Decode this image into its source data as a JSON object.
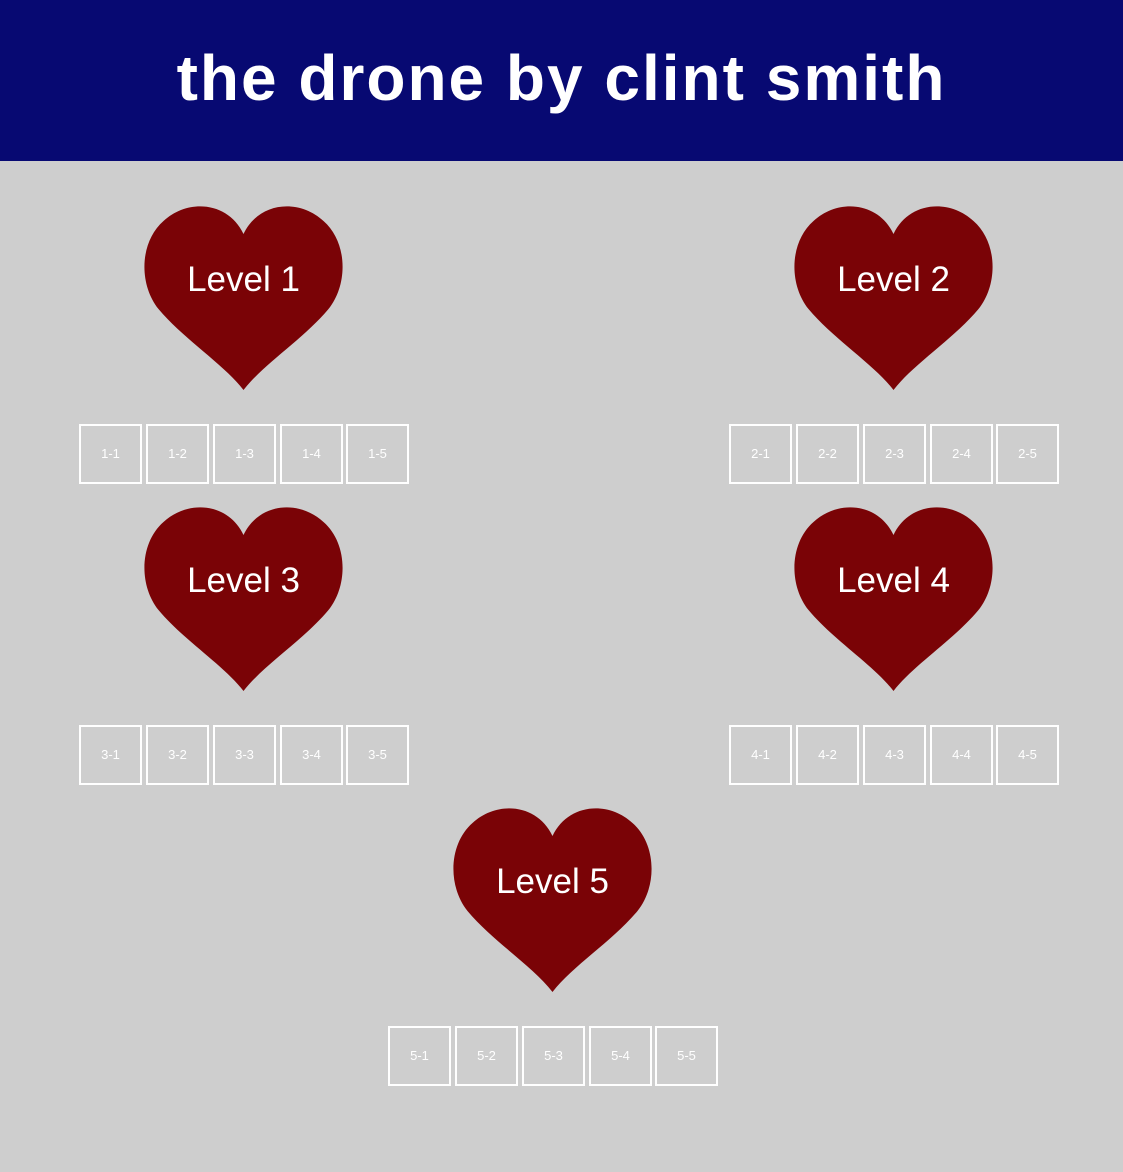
{
  "title": "the drone by clint smith",
  "colors": {
    "header_bg": "#070972",
    "page_bg": "#cecece",
    "heart": "#7a0306",
    "text": "#ffffff"
  },
  "levels": [
    {
      "label": "Level 1",
      "stages": [
        "1-1",
        "1-2",
        "1-3",
        "1-4",
        "1-5"
      ]
    },
    {
      "label": "Level 2",
      "stages": [
        "2-1",
        "2-2",
        "2-3",
        "2-4",
        "2-5"
      ]
    },
    {
      "label": "Level 3",
      "stages": [
        "3-1",
        "3-2",
        "3-3",
        "3-4",
        "3-5"
      ]
    },
    {
      "label": "Level 4",
      "stages": [
        "4-1",
        "4-2",
        "4-3",
        "4-4",
        "4-5"
      ]
    },
    {
      "label": "Level 5",
      "stages": [
        "5-1",
        "5-2",
        "5-3",
        "5-4",
        "5-5"
      ]
    }
  ]
}
